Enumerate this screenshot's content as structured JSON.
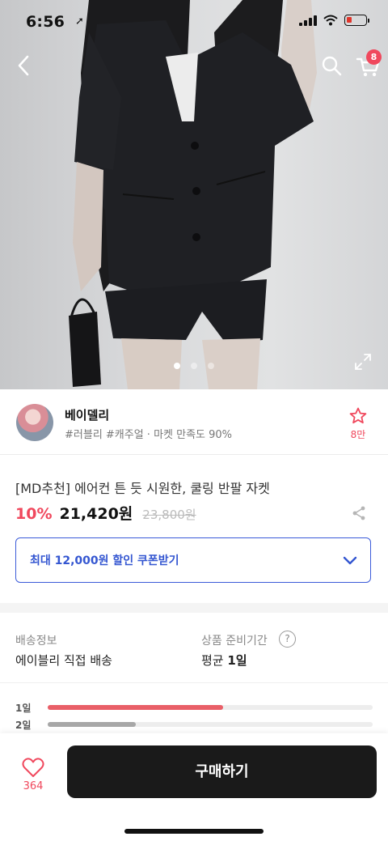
{
  "status_bar": {
    "time": "6:56",
    "location_glyph": "➚"
  },
  "header": {
    "cart_badge": "8"
  },
  "gallery": {
    "dot_count": 3,
    "active_dot": 0
  },
  "seller": {
    "name": "베이델리",
    "tags": "#러블리 #캐주얼 · 마켓 만족도 90%",
    "favorite_count": "8만"
  },
  "product": {
    "title": "[MD추천] 에어컨 튼 듯 시원한, 쿨링 반팔 자켓",
    "discount": "10%",
    "price": "21,420원",
    "original_price": "23,800원"
  },
  "coupon": {
    "label": "최대 12,000원 할인 쿠폰받기"
  },
  "shipping": {
    "label": "배송정보",
    "value": "에이블리 직접 배송",
    "prep_label": "상품 준비기간",
    "help": "?",
    "prep_prefix": "평균 ",
    "prep_value": "1일"
  },
  "prep_distribution": [
    {
      "label": "1일",
      "ratio": 0.54,
      "color": "#e95f68"
    },
    {
      "label": "2일",
      "ratio": 0.27,
      "color": "#a7a7a7"
    }
  ],
  "bottom_bar": {
    "like_count": "364",
    "buy_label": "구매하기"
  },
  "colors": {
    "accent": "#f0485d",
    "link_blue": "#3456d1",
    "button_dark": "#1a1a1a"
  }
}
